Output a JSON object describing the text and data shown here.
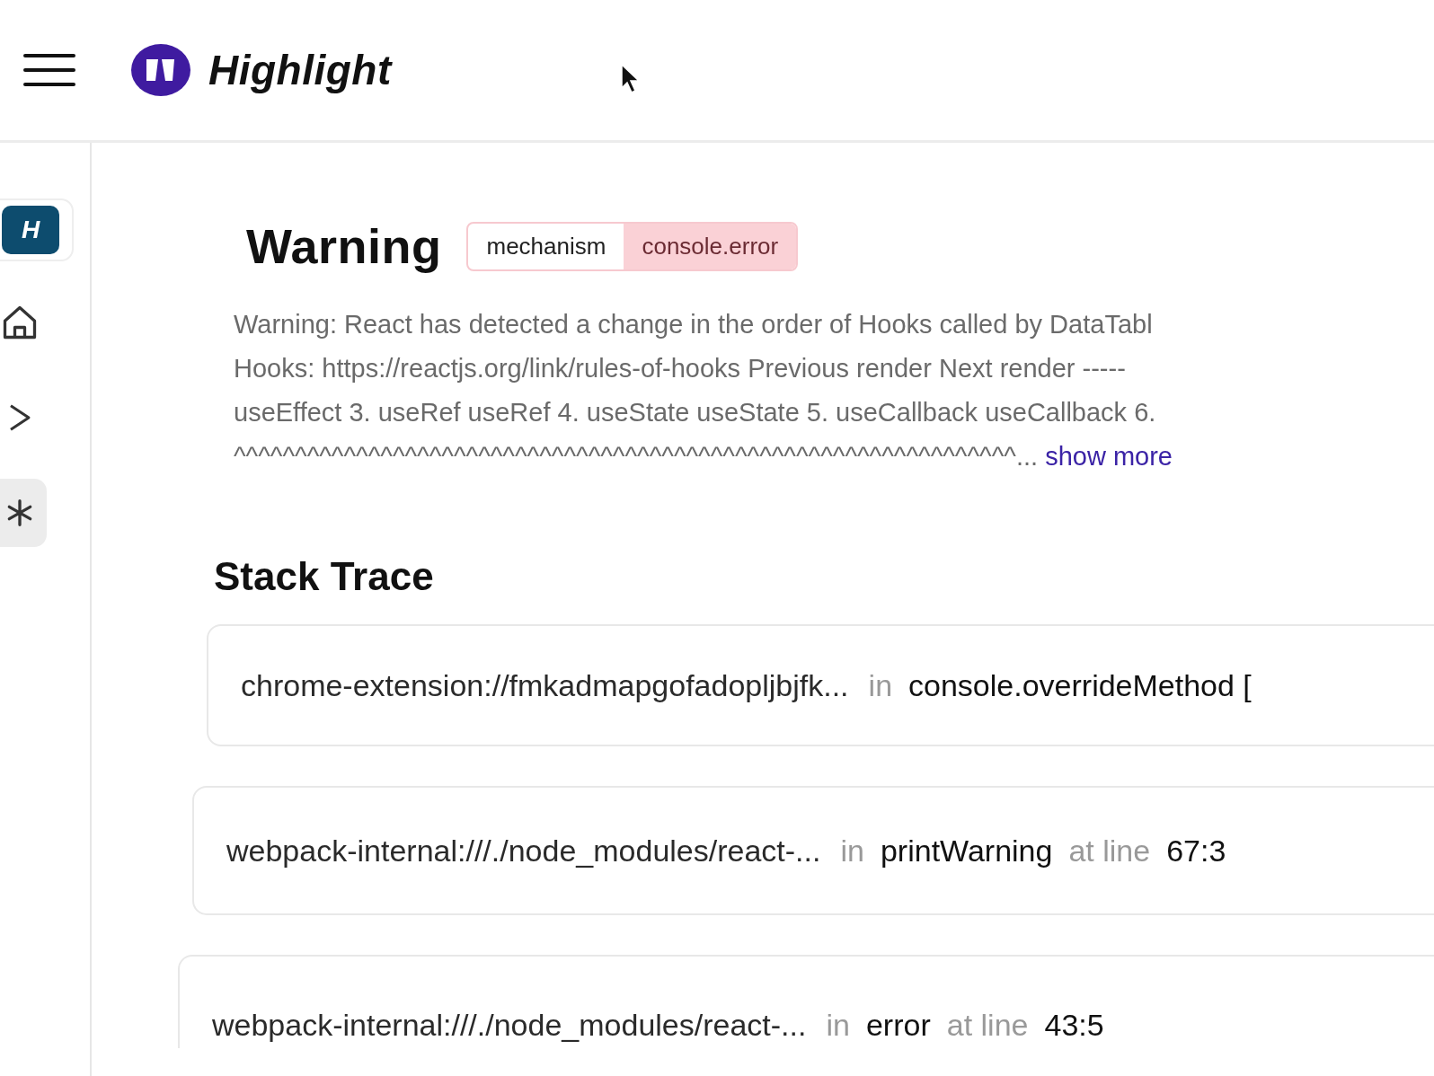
{
  "header": {
    "brand": "Highlight"
  },
  "sidebar": {
    "workspace_badge": "H",
    "items": [
      {
        "kind": "home",
        "selected": false
      },
      {
        "kind": "play",
        "selected": false
      },
      {
        "kind": "bug",
        "selected": true
      }
    ]
  },
  "error": {
    "title": "Warning",
    "tags": [
      {
        "key": "mechanism",
        "value": "console.error"
      }
    ],
    "description_lines": [
      "Warning: React has detected a change in the order of Hooks called by DataTabl",
      "Hooks: https://reactjs.org/link/rules-of-hooks Previous render Next render -----",
      "useEffect 3. useRef useRef 4. useState useState 5. useCallback useCallback 6.",
      "^^^^^^^^^^^^^^^^^^^^^^^^^^^^^^^^^^^^^^^^^^^^^^^^^^^^^^^^^^^^^^^^..."
    ],
    "show_more": "show more"
  },
  "stack_trace": {
    "title": "Stack Trace",
    "frames": [
      {
        "file": "chrome-extension://fmkadmapgofadopljbjfk...",
        "in": "in",
        "function": "console.overrideMethod ["
      },
      {
        "file": "webpack-internal:///./node_modules/react-...",
        "in": "in",
        "function": "printWarning",
        "at_line": "at line",
        "line": "67:3"
      },
      {
        "file": "webpack-internal:///./node_modules/react-...",
        "in": "in",
        "function": "error",
        "at_line": "at line",
        "line": "43:5"
      }
    ]
  }
}
